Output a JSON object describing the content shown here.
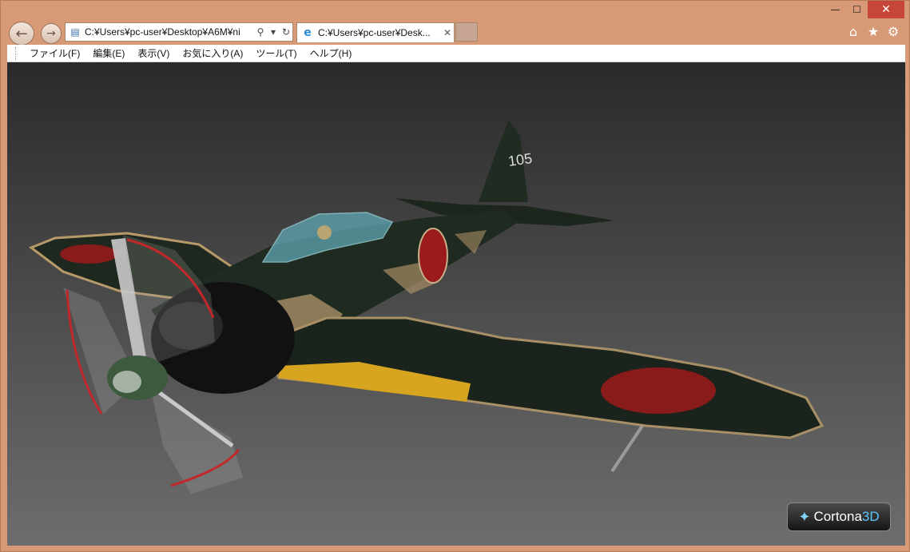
{
  "window": {
    "caption": {
      "minimize": "—",
      "maximize": "☐",
      "close": "✕"
    }
  },
  "nav": {
    "back_icon": "arrow-left-icon",
    "forward_icon": "arrow-right-icon",
    "address": "C:¥Users¥pc-user¥Desktop¥A6M¥ni",
    "tab_title": "C:¥Users¥pc-user¥Desk...",
    "right_icons": [
      "home-icon",
      "star-icon",
      "gear-icon"
    ]
  },
  "menu": {
    "items": [
      "ファイル(F)",
      "編集(E)",
      "表示(V)",
      "お気に入り(A)",
      "ツール(T)",
      "ヘルプ(H)"
    ]
  },
  "viewer": {
    "tail_number": "105",
    "logo_main": "Cortona",
    "logo_suffix": "3D"
  },
  "colors": {
    "frame": "#d89a76",
    "close": "#c7463a",
    "airframe": "#1f2a20",
    "hinomaru": "#9b1b1b",
    "wing_stripe": "#d7a51f"
  }
}
